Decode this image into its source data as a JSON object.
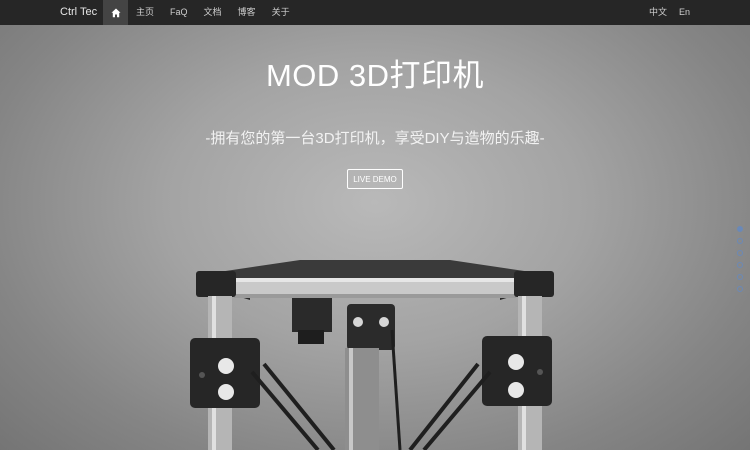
{
  "navbar": {
    "brand": "Ctrl Tec",
    "home_icon": "home-icon",
    "items": [
      "主页",
      "FaQ",
      "文档",
      "博客",
      "关于"
    ],
    "languages": [
      "中文",
      "En"
    ]
  },
  "hero": {
    "title": "MOD 3D打印机",
    "subtitle": "-拥有您的第一台3D打印机，享受DIY与造物的乐趣-",
    "button_label": "LIVE DEMO"
  },
  "side_nav": {
    "dot_count": 6,
    "active_index": 0
  },
  "colors": {
    "navbar_bg": "#262626",
    "hero_bg": "#a3a3a3",
    "dot_accent": "#6a89b8"
  }
}
